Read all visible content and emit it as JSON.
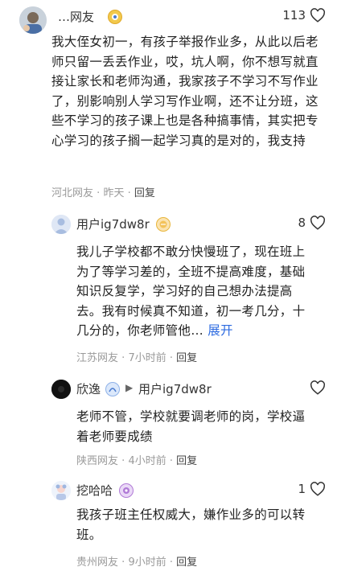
{
  "comments": [
    {
      "user": "…网友",
      "likes": "113",
      "text": "我大侄女初一，有孩子举报作业多，从此以后老师只留一丢丢作业，哎，坑人啊，你不想写就直接让家长和老师沟通，我家孩子不学习不写作业了，别影响别人学习写作业啊，还不让分班，这些不学习的孩子课上也是各种搞事情，其实把专心学习的孩子搁一起学习真的是对的，我支持",
      "location": "河北网友",
      "time": "昨天",
      "reply": "回复"
    },
    {
      "user": "用户ig7dw8r",
      "likes": "8",
      "text": "我儿子学校都不敢分快慢班了，现在班上为了等学习差的，全班不提高难度，基础知识反复学，学习好的自己想办法提高去。我有时候真不知道，初一考几分，十几分的，你老师管他",
      "ellipsis": "…",
      "expand": "展开",
      "location": "江苏网友",
      "time": "7小时前",
      "reply": "回复"
    },
    {
      "user": "欣逸",
      "reply_to": "用户ig7dw8r",
      "likes": "",
      "text": "老师不管，学校就要调老师的岗，学校逼着老师要成绩",
      "location": "陕西网友",
      "time": "4小时前",
      "reply": "回复"
    },
    {
      "user": "挖哈哈",
      "likes": "1",
      "text": "我孩子班主任权威大，嫌作业多的可以转班。",
      "location": "贵州网友",
      "time": "9小时前",
      "reply": "回复"
    }
  ],
  "separator": "·",
  "reply_arrow": "▶",
  "colors": {
    "link": "#2d6be0",
    "meta": "#9a9a9a",
    "badge_gold": "#e8b53a",
    "badge_purple": "#b07ad6"
  }
}
